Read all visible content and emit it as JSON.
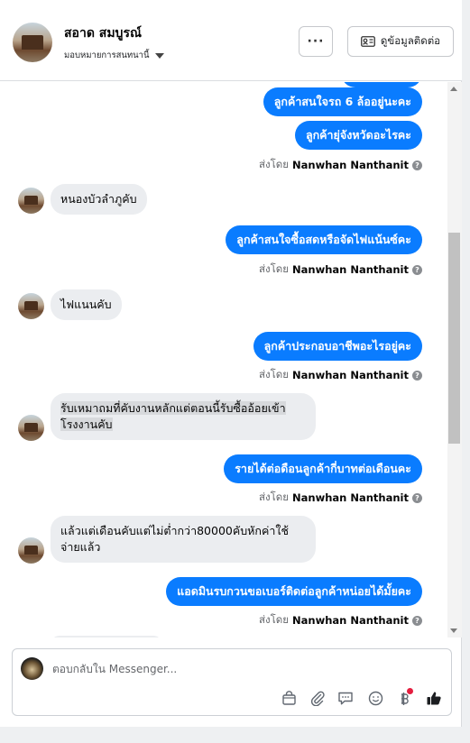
{
  "header": {
    "name": "สอาด สมบูรณ์",
    "assigned": "มอบหมายการสนทนานี้",
    "more_label": "···",
    "contact_label": "ดูข้อมูลติดต่อ"
  },
  "messages": {
    "out1": "ลูกค้าสนใจรถ 6 ล้ออยู่นะคะ",
    "out2": "ลูกค้ายุ่จังหวัดอะไรคะ",
    "in1": "หนองบัวลำภูคับ",
    "out3": "ลูกค้าสนใจซื้อสดหรือจัดไฟแน้นซ์คะ",
    "in2": "ไฟแนนคับ",
    "out4": "ลูกค้าประกอบอาชีพอะไรอยู่คะ",
    "in3_line1": "รับเหมาถมที่คับงานหลักแต่ตอนนี้รับซื้ออ้อยเข้า",
    "in3_line2": "โรงงานคับ",
    "out5": "รายได้ต่อดือนลูกค้ากี่บาทต่อเดือนคะ",
    "in4_line1": "แล้วแต่เดือนคับแต่ไม่ต่ำกว่า80000คับหักค่าใช้",
    "in4_line2": "จ่ายแล้ว",
    "out6": "แอดมินรบกวนขอเบอร์ติดต่อลูกค้าหน่อยได้มั้ยคะ"
  },
  "sent_by": {
    "prefix": "ส่งโดย",
    "agent": "Nanwhan Nanthanit"
  },
  "composer": {
    "placeholder": "ตอบกลับใน Messenger..."
  },
  "colors": {
    "outgoing": "#0a7cff",
    "incoming": "#ebedf0",
    "notification_dot": "#e41e3f"
  }
}
